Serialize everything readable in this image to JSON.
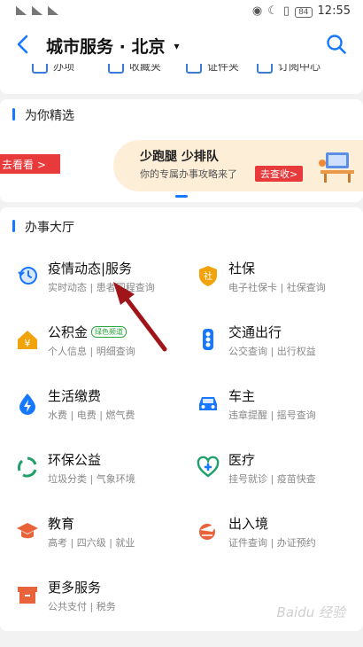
{
  "status_bar": {
    "time": "12:55",
    "battery": "84",
    "left_text": "26 46"
  },
  "header": {
    "title": "城市服务 · 北京",
    "caret": "▾"
  },
  "quick": [
    {
      "label": "办项"
    },
    {
      "label": "收藏夹"
    },
    {
      "label": "证件夹"
    },
    {
      "label": "订阅中心"
    }
  ],
  "recommend": {
    "section_title": "为你精选",
    "left_button": "去看看 >",
    "banner_title": "少跑腿 少排队",
    "banner_subtitle": "你的专属办事攻略来了",
    "banner_button": "去查收>"
  },
  "hall": {
    "section_title": "办事大厅",
    "services": [
      {
        "name": "疫情动态|服务",
        "desc": "实时动态 | 患者同程查询",
        "icon": "clock-icon",
        "color": "#1677ff"
      },
      {
        "name": "社保",
        "desc": "电子社保卡 | 社保查询",
        "icon": "shield-icon",
        "color": "#f0a30a"
      },
      {
        "name": "公积金",
        "tag": "绿色频道",
        "desc": "个人信息 | 明细查询",
        "icon": "house-yen-icon",
        "color": "#f0a30a"
      },
      {
        "name": "交通出行",
        "desc": "公交查询 | 出行权益",
        "icon": "traffic-light-icon",
        "color": "#1677ff"
      },
      {
        "name": "生活缴费",
        "desc": "水费 | 电费 | 燃气费",
        "icon": "drop-bolt-icon",
        "color": "#1677ff"
      },
      {
        "name": "车主",
        "desc": "违章提醒 | 摇号查询",
        "icon": "car-icon",
        "color": "#1677ff"
      },
      {
        "name": "环保公益",
        "desc": "垃圾分类 | 气象环境",
        "icon": "recycle-icon",
        "color": "#22a06b"
      },
      {
        "name": "医疗",
        "desc": "挂号就诊 | 疫苗快查",
        "icon": "medical-icon",
        "color": "#22a06b"
      },
      {
        "name": "教育",
        "desc": "高考 | 四六级 | 就业",
        "icon": "graduation-cap-icon",
        "color": "#e8623a"
      },
      {
        "name": "出入境",
        "desc": "证件查询 | 办证预约",
        "icon": "plane-globe-icon",
        "color": "#e8623a"
      },
      {
        "name": "更多服务",
        "desc": "公共支付 | 税务",
        "icon": "box-icon",
        "color": "#e8623a"
      }
    ]
  },
  "watermark": "Baidu 经验",
  "colors": {
    "accent": "#1677ff",
    "red": "#e8393b",
    "annotation": "#a0151a"
  }
}
